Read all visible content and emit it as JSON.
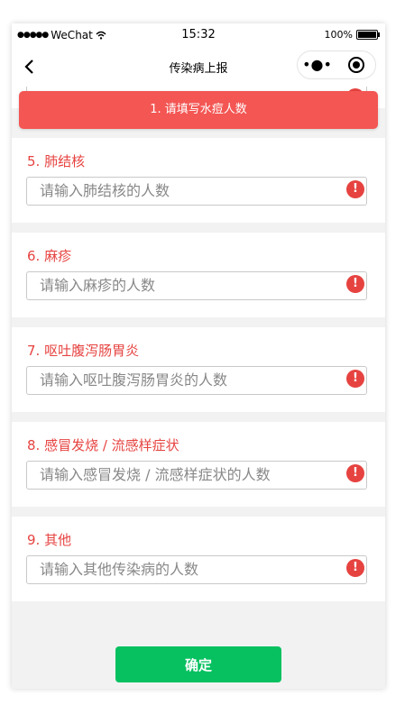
{
  "statusbar": {
    "carrier": "WeChat",
    "time": "15:32",
    "battery": "100%"
  },
  "navbar": {
    "title": "传染病上报",
    "more_label": "•●•"
  },
  "toast": {
    "message": "1. 请填写水痘人数"
  },
  "fields": [
    {
      "label": "5. 肺结核",
      "placeholder": "请输入肺结核的人数"
    },
    {
      "label": "6. 麻疹",
      "placeholder": "请输入麻疹的人数"
    },
    {
      "label": "7. 呕吐腹泻肠胃炎",
      "placeholder": "请输入呕吐腹泻肠胃炎的人数"
    },
    {
      "label": "8. 感冒发烧 / 流感样症状",
      "placeholder": "请输入感冒发烧 / 流感样症状的人数"
    },
    {
      "label": "9. 其他",
      "placeholder": "请输入其他传染病的人数"
    }
  ],
  "warning_glyph": "!",
  "confirm_label": "确定",
  "colors": {
    "accent_red": "#e64340",
    "toast_red": "#f35653",
    "primary_green": "#07c160"
  }
}
